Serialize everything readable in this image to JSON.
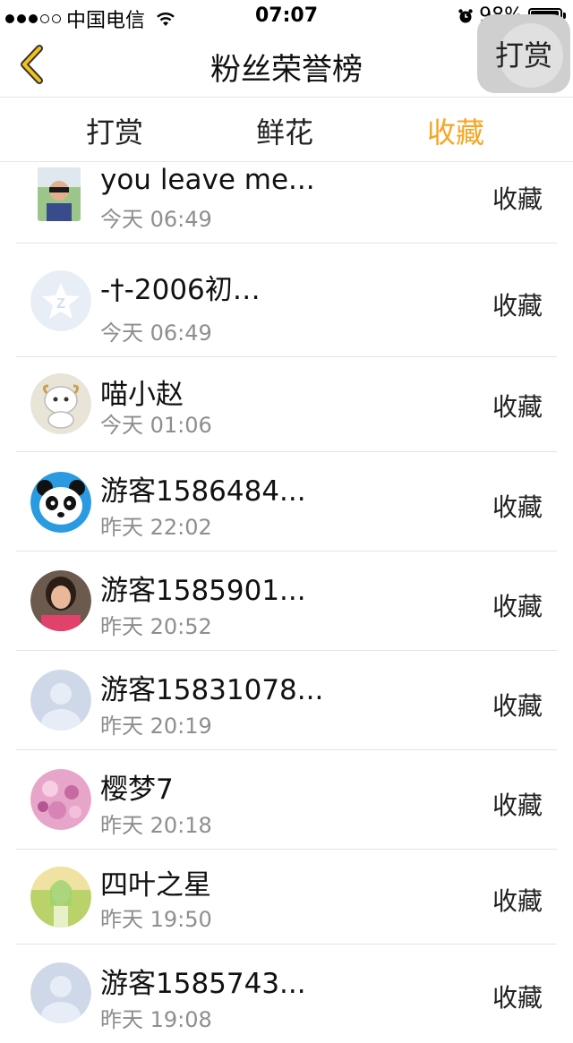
{
  "status_bar": {
    "carrier": "中国电信",
    "time": "07:07",
    "battery": "98%",
    "battery_level": 0.98
  },
  "nav": {
    "title": "粉丝荣誉榜",
    "right_button": "打赏"
  },
  "tabs": [
    {
      "label": "打赏",
      "active": false
    },
    {
      "label": "鲜花",
      "active": false
    },
    {
      "label": "收藏",
      "active": true
    }
  ],
  "accent_color": "#f5a623",
  "list": [
    {
      "name": "you leave me...",
      "time": "今天 06:49",
      "action": "收藏",
      "avatar": "photo-avatar-icon"
    },
    {
      "name": "-†-2006初…",
      "time": "今天 06:49",
      "action": "收藏",
      "avatar": "default-star-avatar-icon"
    },
    {
      "name": "喵小赵",
      "time": "今天 01:06",
      "action": "收藏",
      "avatar": "cartoon-sheep-avatar-icon"
    },
    {
      "name": "游客1586484...",
      "time": "昨天 22:02",
      "action": "收藏",
      "avatar": "panda-avatar-icon"
    },
    {
      "name": "游客1585901...",
      "time": "昨天 20:52",
      "action": "收藏",
      "avatar": "photo-avatar-icon"
    },
    {
      "name": "游客15831078...",
      "time": "昨天 20:19",
      "action": "收藏",
      "avatar": "default-user-avatar-icon"
    },
    {
      "name": "樱梦7",
      "time": "昨天 20:18",
      "action": "收藏",
      "avatar": "flower-avatar-icon"
    },
    {
      "name": "四叶之星",
      "time": "昨天 19:50",
      "action": "收藏",
      "avatar": "anime-avatar-icon"
    },
    {
      "name": "游客1585743...",
      "time": "昨天 19:08",
      "action": "收藏",
      "avatar": "default-user-avatar-icon"
    }
  ]
}
